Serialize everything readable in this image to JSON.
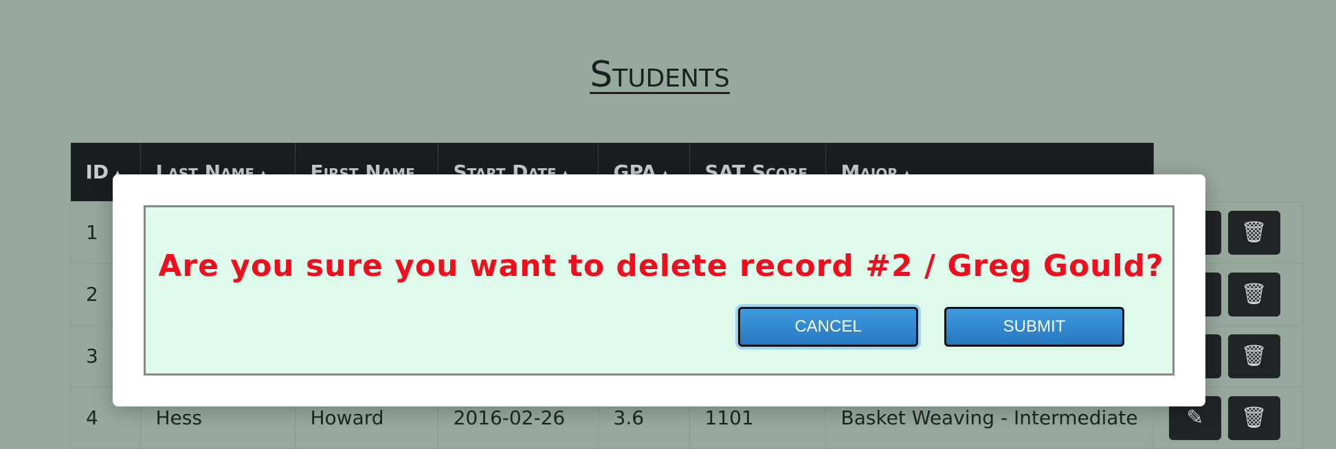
{
  "page": {
    "title": "Students"
  },
  "table": {
    "columns": [
      {
        "label": "ID",
        "sortable": true
      },
      {
        "label": "Last Name",
        "sortable": true
      },
      {
        "label": "First Name",
        "sortable": false
      },
      {
        "label": "Start Date",
        "sortable": true
      },
      {
        "label": "GPA",
        "sortable": true
      },
      {
        "label": "SAT Score",
        "sortable": false
      },
      {
        "label": "Major",
        "sortable": true
      }
    ],
    "rows": [
      {
        "id": "1",
        "last": "",
        "first": "",
        "start": "",
        "gpa": "",
        "sat": "",
        "major": ""
      },
      {
        "id": "2",
        "last": "",
        "first": "",
        "start": "",
        "gpa": "",
        "sat": "",
        "major": ""
      },
      {
        "id": "3",
        "last": "",
        "first": "",
        "start": "",
        "gpa": "",
        "sat": "",
        "major": ""
      },
      {
        "id": "4",
        "last": "Hess",
        "first": "Howard",
        "start": "2016-02-26",
        "gpa": "3.6",
        "sat": "1101",
        "major": "Basket Weaving - Intermediate"
      }
    ],
    "sort_icon": "▲",
    "edit_icon": "✎",
    "delete_icon": "🗑"
  },
  "modal": {
    "message": "Are you sure you want to delete record #2 / Greg Gould?",
    "cancel_label": "CANCEL",
    "submit_label": "SUBMIT"
  }
}
